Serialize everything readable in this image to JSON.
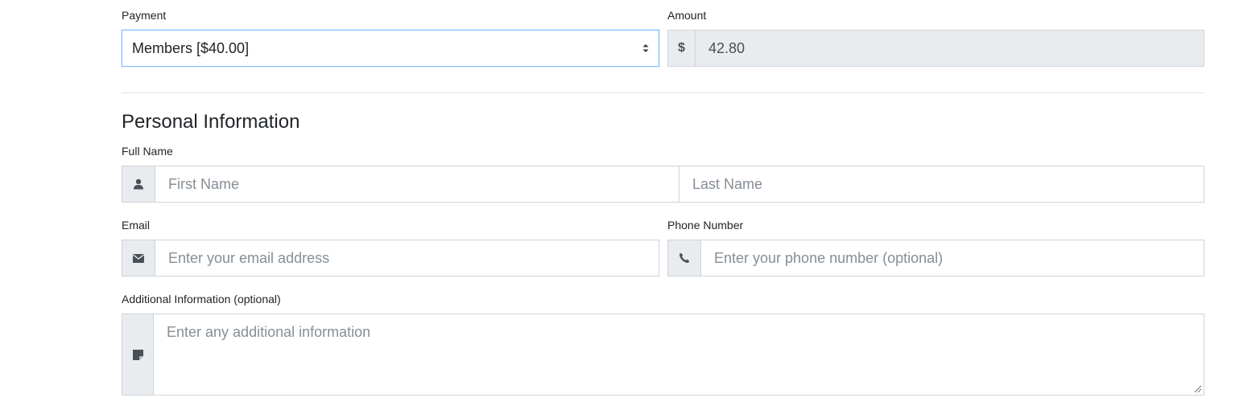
{
  "payment": {
    "label": "Payment",
    "selected": "Members [$40.00]"
  },
  "amount": {
    "label": "Amount",
    "currency_symbol": "$",
    "value": "42.80"
  },
  "personal_info": {
    "title": "Personal Information",
    "full_name": {
      "label": "Full Name",
      "first_placeholder": "First Name",
      "last_placeholder": "Last Name",
      "icon": "user-icon"
    },
    "email": {
      "label": "Email",
      "placeholder": "Enter your email address",
      "icon": "envelope-icon"
    },
    "phone": {
      "label": "Phone Number",
      "placeholder": "Enter your phone number (optional)",
      "icon": "phone-icon"
    },
    "additional": {
      "label": "Additional Information (optional)",
      "placeholder": "Enter any additional information",
      "icon": "sticky-note-icon"
    }
  },
  "colors": {
    "addon_bg": "#e9ecef",
    "border": "#ced4da",
    "focus_border": "#80bdff",
    "placeholder": "#868e96"
  }
}
